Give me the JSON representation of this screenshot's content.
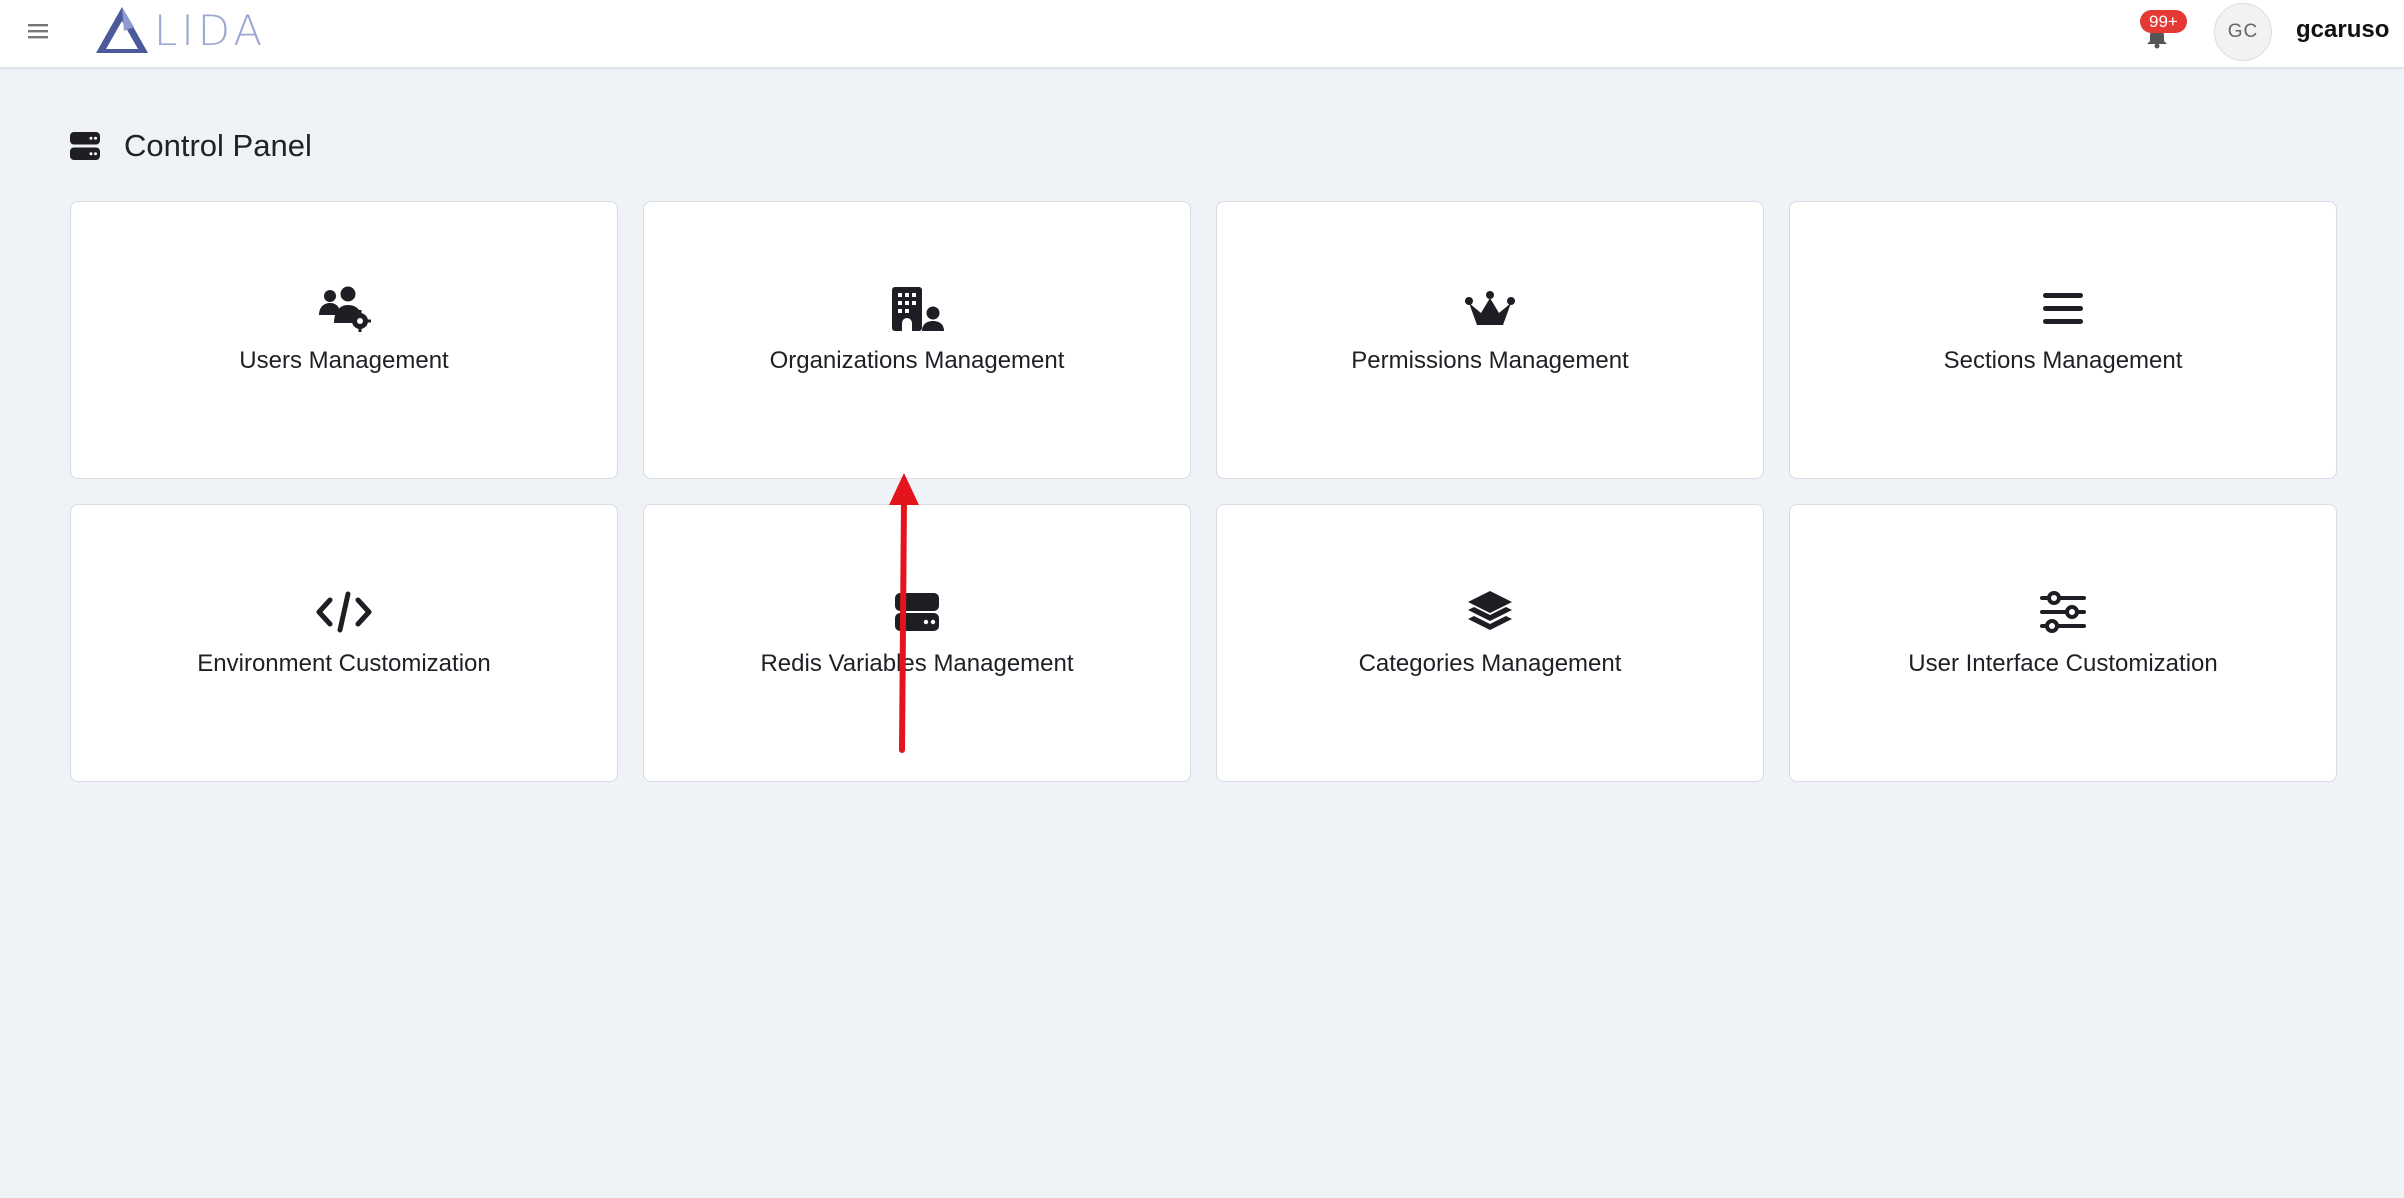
{
  "app": {
    "logo_text": "LIDA",
    "notifications_badge": "99+",
    "avatar_initials": "GC",
    "username": "gcaruso"
  },
  "page": {
    "title": "Control Panel",
    "title_icon": "server-icon"
  },
  "cards": [
    {
      "label": "Users Management",
      "icon": "users-gear-icon"
    },
    {
      "label": "Organizations Management",
      "icon": "building-user-icon"
    },
    {
      "label": "Permissions Management",
      "icon": "crown-icon"
    },
    {
      "label": "Sections Management",
      "icon": "bars-icon"
    },
    {
      "label": "Environment Customization",
      "icon": "code-icon"
    },
    {
      "label": "Redis Variables Management",
      "icon": "server-icon"
    },
    {
      "label": "Categories Management",
      "icon": "layer-group-icon"
    },
    {
      "label": "User Interface Customization",
      "icon": "sliders-icon"
    }
  ],
  "colors": {
    "background": "#eff2f7",
    "badge": "#e53935",
    "logo": "#9ca7d2",
    "annotation_arrow": "#e3141c"
  }
}
